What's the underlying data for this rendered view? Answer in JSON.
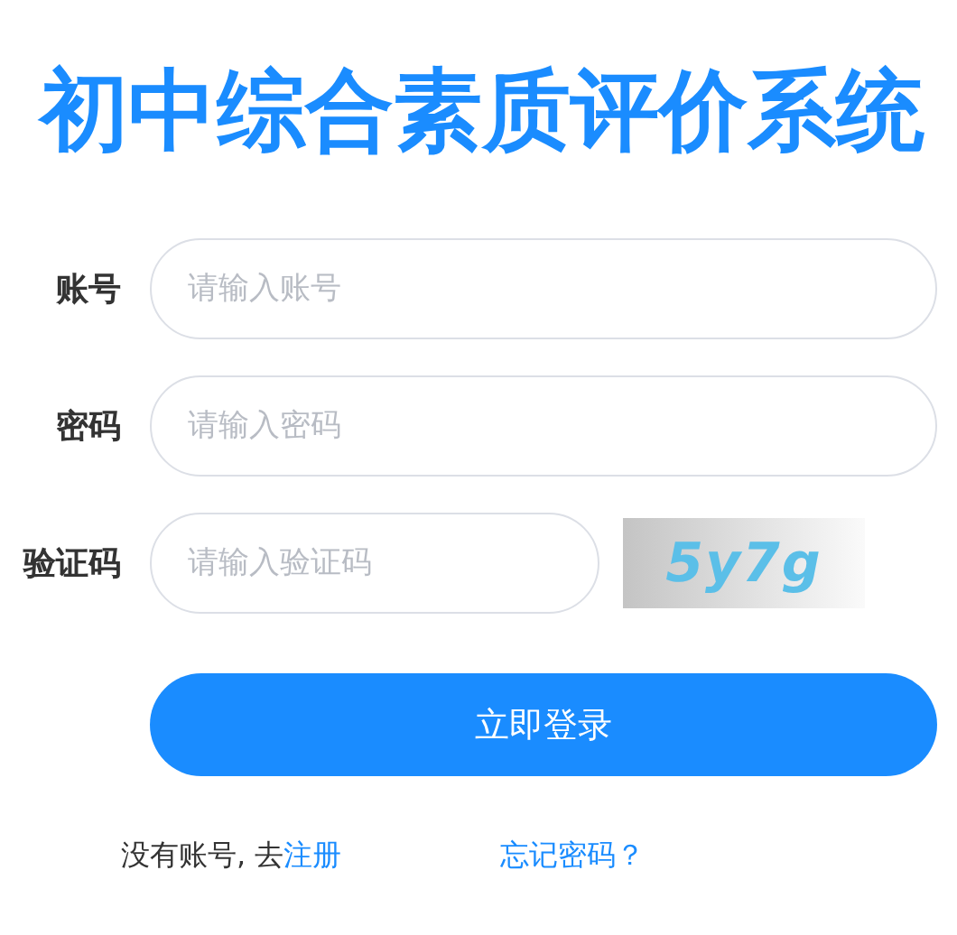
{
  "title": "初中综合素质评价系统",
  "fields": [
    {
      "label": "账号",
      "placeholder": "请输入账号"
    },
    {
      "label": "密码",
      "placeholder": "请输入密码"
    },
    {
      "label": "验证码",
      "placeholder": "请输入验证码"
    }
  ],
  "captcha": "5y7g",
  "submit": "立即登录",
  "register": {
    "prompt": "没有账号, 去",
    "link": "注册"
  },
  "forgot": "忘记密码？"
}
